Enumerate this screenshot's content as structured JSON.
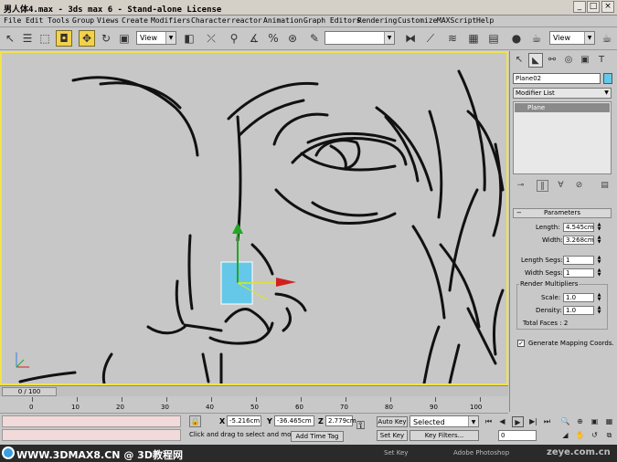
{
  "window": {
    "title": "男人体4.max - 3ds max 6 - Stand-alone License",
    "min": "_",
    "max": "□",
    "close": "×"
  },
  "menu": [
    "File",
    "Edit",
    "Tools",
    "Group",
    "Views",
    "Create",
    "Modifiers",
    "Character",
    "reactor",
    "Animation",
    "Graph Editors",
    "Rendering",
    "Customize",
    "MAXScript",
    "Help"
  ],
  "toolbar": {
    "view_dropdown": "View",
    "selection_set_dropdown": "",
    "view_dropdown_right": "View"
  },
  "command_panel": {
    "object_name": "Plane02",
    "modifier_list": "Modifier List",
    "stack_item": "Plane",
    "rollout_title": "Parameters",
    "length_label": "Length:",
    "length_value": "4.545cm",
    "width_label": "Width:",
    "width_value": "3.268cm",
    "length_segs_label": "Length Segs:",
    "length_segs_value": "1",
    "width_segs_label": "Width Segs:",
    "width_segs_value": "1",
    "render_group": "Render Multipliers",
    "scale_label": "Scale:",
    "scale_value": "1.0",
    "density_label": "Density:",
    "density_value": "1.0",
    "total_faces": "Total Faces : 2",
    "gen_mapping": "Generate Mapping Coords."
  },
  "timeline": {
    "slider": "0 / 100",
    "ticks": [
      "0",
      "10",
      "20",
      "30",
      "40",
      "50",
      "60",
      "70",
      "80",
      "90",
      "100"
    ]
  },
  "status": {
    "x_label": "X",
    "x_value": "-5.216cm",
    "y_label": "Y",
    "y_value": "-36.465cm",
    "z_label": "Z",
    "z_value": "2.779cm",
    "prompt": "Click and drag to select and move",
    "add_time_tag": "Add Time Tag",
    "auto_key": "Auto Key",
    "set_key": "Set Key",
    "selected": "Selected",
    "key_filters": "Key Filters...",
    "frame": "0"
  },
  "taskbar": {
    "watermark": "WWW.3DMAX8.CN @ 3D教程网",
    "task1": "Set Key",
    "task2": "Adobe Photoshop",
    "right_watermark": "zeye.com.cn"
  },
  "colors": {
    "viewport_border": "#f0e34a",
    "plane_fill": "#66c8e8",
    "stack_highlight": "#8a8a8a"
  }
}
